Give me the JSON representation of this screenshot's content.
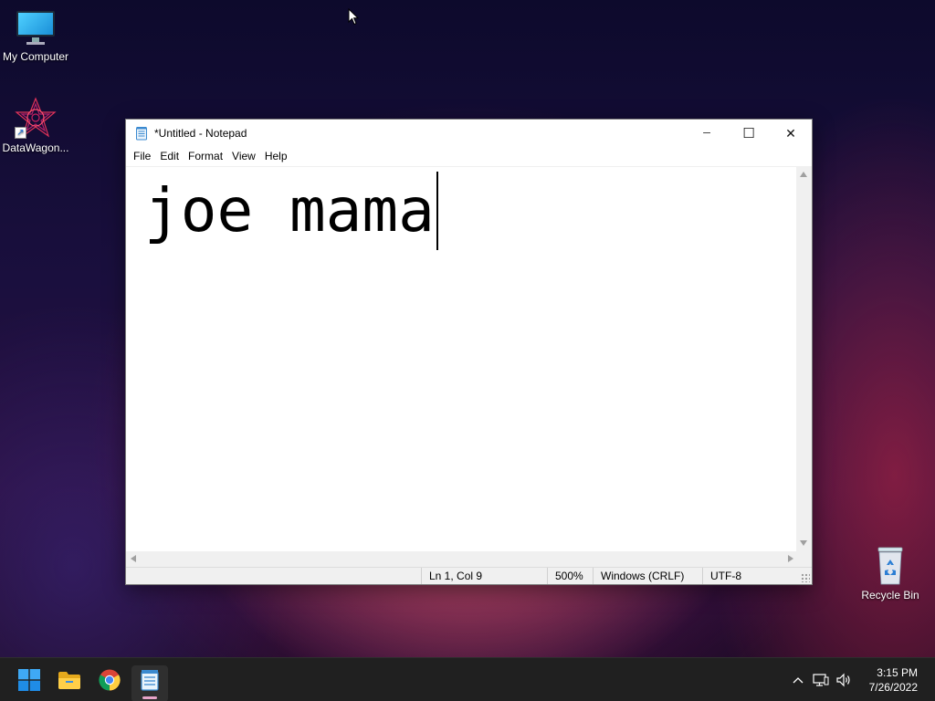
{
  "desktop": {
    "icons": [
      {
        "label": "My Computer",
        "icon": "monitor-icon"
      },
      {
        "label": "DataWagon...",
        "icon": "datawagon-icon"
      },
      {
        "label": "Recycle Bin",
        "icon": "recycle-bin-icon"
      }
    ]
  },
  "notepad": {
    "title": "*Untitled - Notepad",
    "menu": [
      "File",
      "Edit",
      "Format",
      "View",
      "Help"
    ],
    "content": "joe mama",
    "window_buttons": {
      "minimize": "─",
      "maximize": "☐",
      "close": "✕"
    },
    "status": {
      "position": "Ln 1, Col 9",
      "zoom": "500%",
      "line_endings": "Windows (CRLF)",
      "encoding": "UTF-8"
    }
  },
  "taskbar": {
    "apps": [
      {
        "name": "Start",
        "icon": "windows-start-icon"
      },
      {
        "name": "File Explorer",
        "icon": "folder-icon"
      },
      {
        "name": "Google Chrome",
        "icon": "chrome-icon"
      },
      {
        "name": "Notepad",
        "icon": "notepad-icon",
        "active": true
      }
    ],
    "tray_icons": [
      "chevron-up-icon",
      "network-icon",
      "volume-icon"
    ],
    "clock": {
      "time": "3:15 PM",
      "date": "7/26/2022"
    }
  },
  "colors": {
    "taskbar_bg": "#202020",
    "accent_indicator": "#e7a4c9",
    "window_bg": "#ffffff",
    "statusbar_bg": "#f0f0f0"
  }
}
